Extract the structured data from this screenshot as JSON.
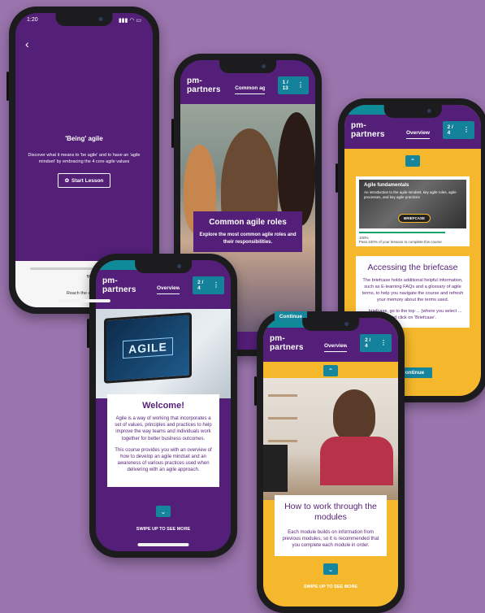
{
  "colors": {
    "purple": "#541f78",
    "teal": "#15869c",
    "yellow": "#f5b82c",
    "background": "#9a74ad"
  },
  "phone1": {
    "status_time": "1:20",
    "status_icons": "▮▮▮ ◠ ▭",
    "title": "'Being' agile",
    "description": "Discover what it means to 'be agile' and to have an 'agile mindset' by embracing the 4 core agile values",
    "start_button": "Start Lesson",
    "best_label": "YOUR BEST S",
    "reach_text": "Reach the end of this less"
  },
  "phone2": {
    "logo": "pm-partners",
    "tab": "Common ag...",
    "page": "1 / 13",
    "card_title": "Common agile roles",
    "card_subtitle": "Explore the most common agile roles and their responsibilities.",
    "continue": "Continue"
  },
  "phone3": {
    "logo": "pm-partners",
    "tab": "Overview",
    "page": "2 / 4",
    "lesson_title": "Agile fundamentals",
    "lesson_text": "An introduction to the agile mindset, key agile roles, agile processes, and key agile practices",
    "briefcase_pill": "BRIEFCASE",
    "progress_percent": 100,
    "progress_label": "100%",
    "pass_text": "Pass 100% of your lessons to complete this course",
    "card_title": "Accessing the briefcase",
    "card_text_1": "The briefcase holds additional helpful information, such as E-learning FAQs and a glossary of agile terms, to help you navigate the course and refresh your memory about the terms used.",
    "card_text_2": "... briefcase, go to the top ... (where you select ... and click on 'Briefcase'.",
    "continue": "Continue"
  },
  "phone4": {
    "logo": "pm-partners",
    "tab": "Overview",
    "page": "2 / 4",
    "image_word": "AGILE",
    "card_title": "Welcome!",
    "card_text_1": "Agile is a way of working that incorporates a set of values, principles and practices to help improve the way teams and individuals work together for better business outcomes.",
    "card_text_2": "This course provides you with an overview of how to develop an agile mindset and an awareness of various practices used when delivering with an agile approach.",
    "swipe": "SWIPE UP TO SEE MORE"
  },
  "phone5": {
    "logo": "pm-partners",
    "tab": "Overview",
    "page": "2 / 4",
    "card_title": "How to work through the modules",
    "card_text": "Each module builds on information from previous modules, so it is recommended that you complete each module in order.",
    "swipe": "SWIPE UP TO SEE MORE"
  }
}
